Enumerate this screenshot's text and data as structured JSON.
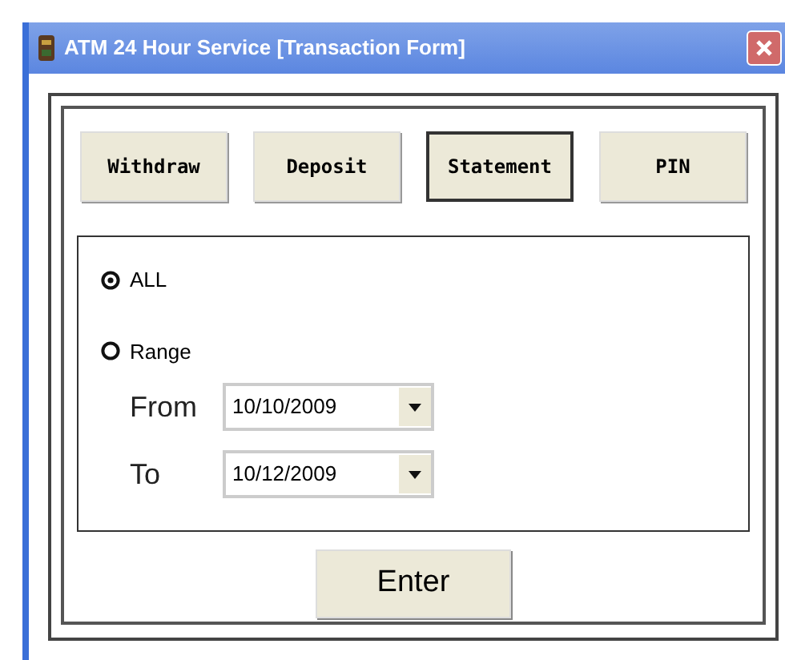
{
  "window": {
    "title": "ATM 24 Hour Service [Transaction Form]"
  },
  "tabs": [
    {
      "label": "Withdraw",
      "selected": false
    },
    {
      "label": "Deposit",
      "selected": false
    },
    {
      "label": "Statement",
      "selected": true
    },
    {
      "label": "PIN",
      "selected": false
    }
  ],
  "options": [
    {
      "label": "ALL",
      "selected": true
    },
    {
      "label": "Range",
      "selected": false
    }
  ],
  "dates": [
    {
      "label": "From",
      "value": "10/10/2009"
    },
    {
      "label": "To",
      "value": "10/12/2009"
    }
  ],
  "button": "Enter"
}
